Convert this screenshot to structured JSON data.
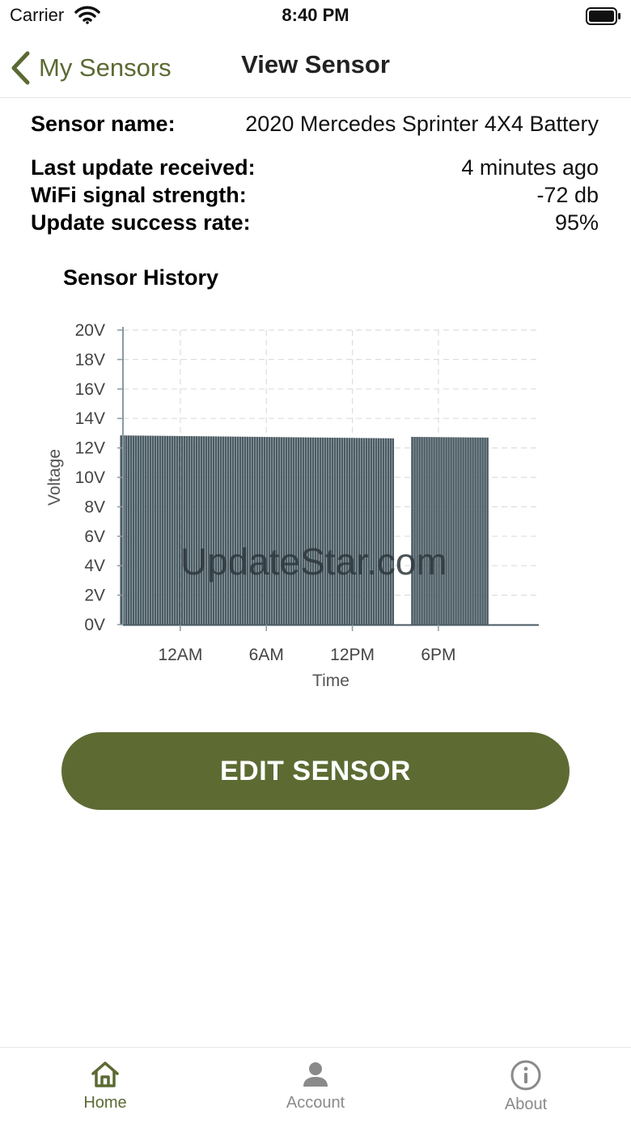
{
  "status_bar": {
    "carrier": "Carrier",
    "time": "8:40 PM"
  },
  "nav": {
    "back_label": "My Sensors",
    "title": "View Sensor"
  },
  "sensor": {
    "name_label": "Sensor name:",
    "name_value": "2020 Mercedes Sprinter 4X4 Battery",
    "stats": [
      {
        "label": "Last update received:",
        "value": "4 minutes ago"
      },
      {
        "label": "WiFi signal strength:",
        "value": "-72 db"
      },
      {
        "label": "Update success rate:",
        "value": "95%"
      }
    ]
  },
  "chart_title": "Sensor History",
  "chart_data": {
    "type": "bar",
    "xlabel": "Time",
    "ylabel": "Voltage",
    "ylim": [
      0,
      20
    ],
    "y_ticks": [
      "0V",
      "2V",
      "4V",
      "6V",
      "8V",
      "10V",
      "12V",
      "14V",
      "16V",
      "18V",
      "20V"
    ],
    "x_range_hours": [
      -4,
      25
    ],
    "x_ticks": [
      {
        "label": "12AM",
        "hour": 0
      },
      {
        "label": "6AM",
        "hour": 6
      },
      {
        "label": "12PM",
        "hour": 12
      },
      {
        "label": "6PM",
        "hour": 18
      }
    ],
    "series": [
      {
        "values": [
          {
            "from_hour": -4.2,
            "to_hour": 14.8,
            "start_value": 12.85,
            "end_value": 12.65
          },
          {
            "from_hour": 16.1,
            "to_hour": 21.4,
            "start_value": 12.75,
            "end_value": 12.7
          }
        ]
      }
    ],
    "grid": true,
    "bar_color": "#4a5b63",
    "watermark": "UpdateStar.com"
  },
  "edit_button": "EDIT SENSOR",
  "tabs": [
    {
      "label": "Home",
      "icon": "home-icon"
    },
    {
      "label": "Account",
      "icon": "person-icon"
    },
    {
      "label": "About",
      "icon": "info-icon"
    }
  ],
  "colors": {
    "accent": "#5d6b33",
    "inactive": "#8a8a8a",
    "bars": "#4a5b63"
  }
}
